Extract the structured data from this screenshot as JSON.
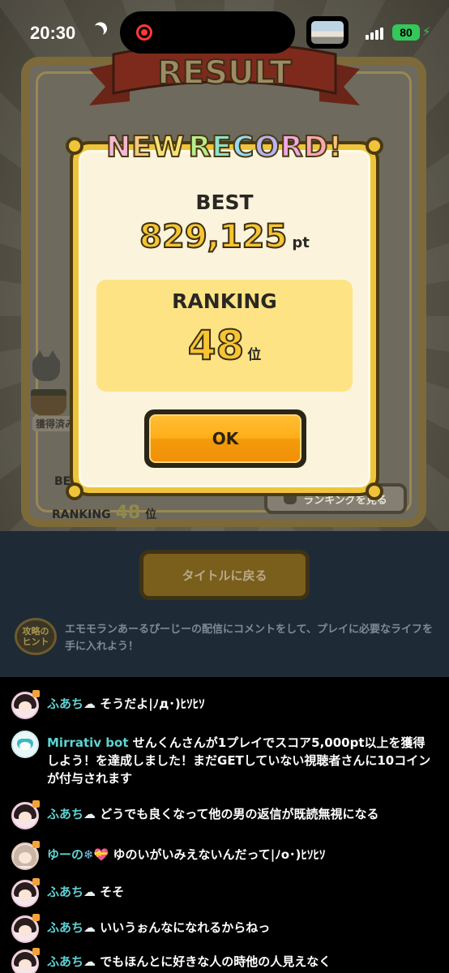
{
  "status_bar": {
    "time": "20:30",
    "battery": "80"
  },
  "game": {
    "result_title": "RESULT",
    "acquired_label": "獲得済み",
    "best_label_bg": "BEST",
    "ranking_label_bg": "RANKING",
    "ranking_value_bg": "48",
    "ranking_unit_bg": "位",
    "view_ranking_button": "ランキングを見る",
    "back_to_title_button": "タイトルに戻る",
    "hint_badge": "攻略のヒント",
    "hint_text": "エモモランあーるぴーじーの配信にコメントをして、プレイに必要なライフを手に入れよう！"
  },
  "dialog": {
    "headline": "NEW RECORD!",
    "headline_colors": [
      "#f5b8d5",
      "#f3c87f",
      "#f6e27a",
      "#b9ee8b",
      "#8fe0c9",
      "#94d9f5",
      "#b7b3f4",
      "#f0a9e4",
      "#f8a7b5",
      "#f7c37c",
      "#f0e67a"
    ],
    "best_label": "BEST",
    "best_score": "829,125",
    "best_unit": "pt",
    "ranking_label": "RANKING",
    "ranking_value": "48",
    "ranking_unit": "位",
    "ok_button": "OK"
  },
  "chat": {
    "messages": [
      {
        "user": "ふあち",
        "icon": "cloud-icon",
        "text": " そうだよ|ﾉд･)ﾋｿﾋｿ"
      },
      {
        "user": "Mirrativ bot",
        "icon": "",
        "text": " せんくんさんが1プレイでスコア5,000pt以上を獲得しよう！を達成しました！まだGETしていない視聴者さんに10コインが付与されます"
      },
      {
        "user": "ふあち",
        "icon": "cloud-icon",
        "text": " どうでも良くなって他の男の返信が既読無視になる"
      },
      {
        "user": "ゆーの",
        "icon": "snowflake-heart-icon",
        "text": " ゆのいがいみえないんだって|ﾉo･)ﾋｿﾋｿ"
      },
      {
        "user": "ふあち",
        "icon": "cloud-icon",
        "text": " そそ"
      },
      {
        "user": "ふあち",
        "icon": "cloud-icon",
        "text": " いいうぉんなになれるからねっ"
      },
      {
        "user": "ふあち",
        "icon": "cloud-icon",
        "text": " でもほんとに好きな人の時他の人見えなく"
      }
    ]
  }
}
